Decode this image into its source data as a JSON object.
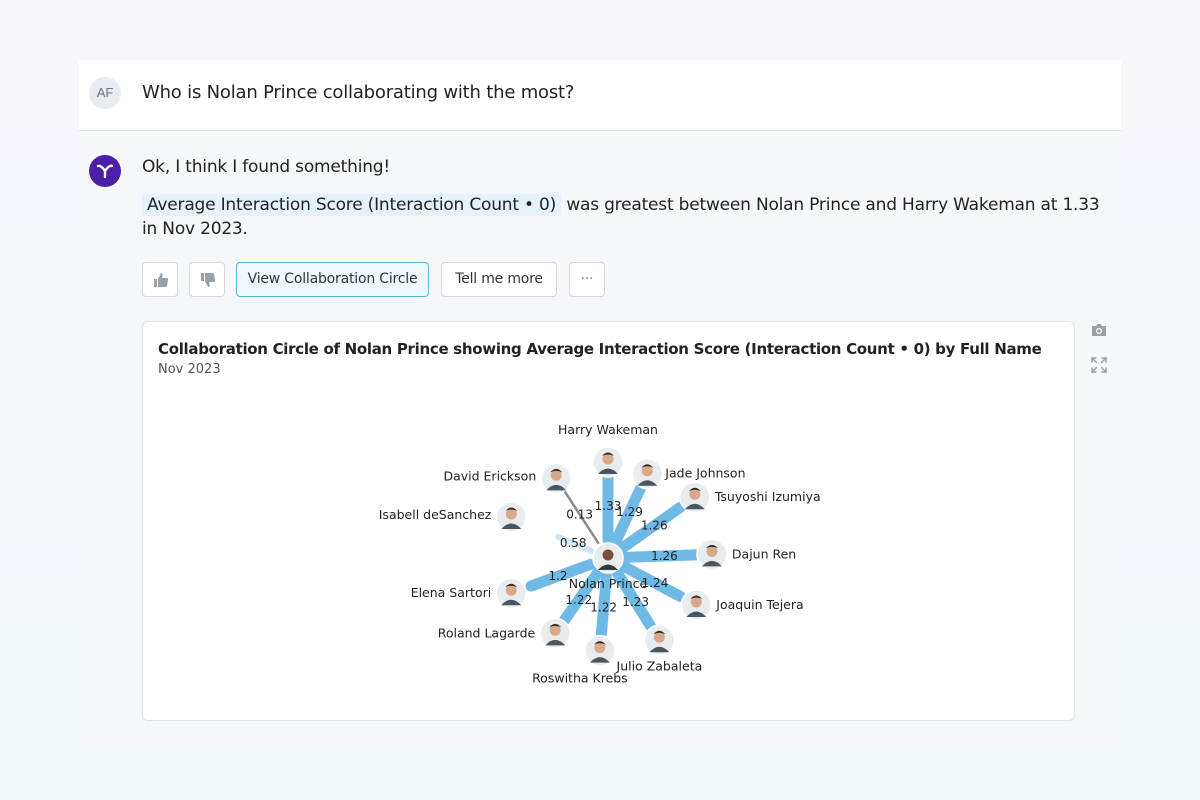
{
  "question": {
    "avatar_initials": "AF",
    "text": "Who is Nolan Prince collaborating with the most?"
  },
  "answer": {
    "intro": "Ok, I think I found something!",
    "metric": "Average Interaction Score (Interaction Count • 0)",
    "rest": " was greatest between Nolan Prince and Harry Wakeman at 1.33 in Nov 2023."
  },
  "actions": {
    "thumbs_up_icon": "thumbs-up-icon",
    "thumbs_down_icon": "thumbs-down-icon",
    "view_label": "View Collaboration Circle",
    "tell_more_label": "Tell me more",
    "more_label": "···"
  },
  "chart": {
    "title": "Collaboration Circle of Nolan Prince showing Average Interaction Score (Interaction Count • 0) by Full Name",
    "subtitle": "Nov 2023"
  },
  "tools": {
    "camera_icon": "camera-icon",
    "expand_icon": "expand-icon"
  },
  "colors": {
    "spoke_blue": "#6fb9e6",
    "spoke_light": "#cfe6f5",
    "spoke_gray": "#8a8a8a",
    "brand_purple": "#4b1fa8",
    "chip_bg": "#e4f3fb"
  },
  "chart_data": {
    "type": "radial",
    "center": "Nolan Prince",
    "nodes": [
      {
        "name": "Harry Wakeman",
        "value": 1.33
      },
      {
        "name": "Jade Johnson",
        "value": 1.29
      },
      {
        "name": "Tsuyoshi Izumiya",
        "value": 1.26
      },
      {
        "name": "Dajun Ren",
        "value": 1.26
      },
      {
        "name": "Joaquin Tejera",
        "value": 1.24
      },
      {
        "name": "Julio Zabaleta",
        "value": 1.23
      },
      {
        "name": "Roswitha Krebs",
        "value": 1.22
      },
      {
        "name": "Roland Lagarde",
        "value": 1.22
      },
      {
        "name": "Elena Sartori",
        "value": 1.2
      },
      {
        "name": "Isabell deSanchez",
        "value": 0.58
      },
      {
        "name": "David Erickson",
        "value": 0.13
      }
    ]
  }
}
